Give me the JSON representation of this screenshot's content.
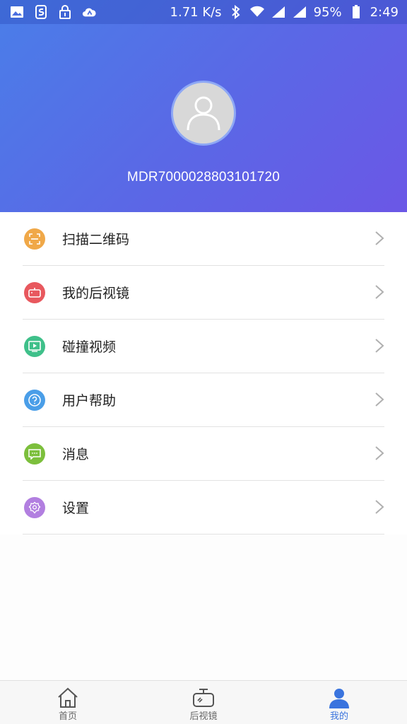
{
  "status_bar": {
    "speed": "1.71 K/s",
    "battery": "95%",
    "time": "2:49"
  },
  "profile": {
    "device_id": "MDR7000028803101720"
  },
  "menu": {
    "items": [
      {
        "label": "扫描二维码",
        "icon": "scan-qr-icon",
        "color": "#f0a848"
      },
      {
        "label": "我的后视镜",
        "icon": "rearview-mirror-icon",
        "color": "#e8585e"
      },
      {
        "label": "碰撞视频",
        "icon": "video-play-icon",
        "color": "#3fc08a"
      },
      {
        "label": "用户帮助",
        "icon": "help-icon",
        "color": "#4a9ee8"
      },
      {
        "label": "消息",
        "icon": "message-icon",
        "color": "#7cbf3c"
      },
      {
        "label": "设置",
        "icon": "settings-gear-icon",
        "color": "#b27fe0"
      }
    ]
  },
  "tabbar": {
    "tabs": [
      {
        "label": "首页",
        "icon": "home-icon"
      },
      {
        "label": "后视镜",
        "icon": "rearview-mirror-icon"
      },
      {
        "label": "我的",
        "icon": "user-icon",
        "active": true
      }
    ]
  },
  "colors": {
    "header_gradient_start": "#4a7ee8",
    "header_gradient_end": "#6b57e6",
    "active_tab": "#3a74de"
  }
}
